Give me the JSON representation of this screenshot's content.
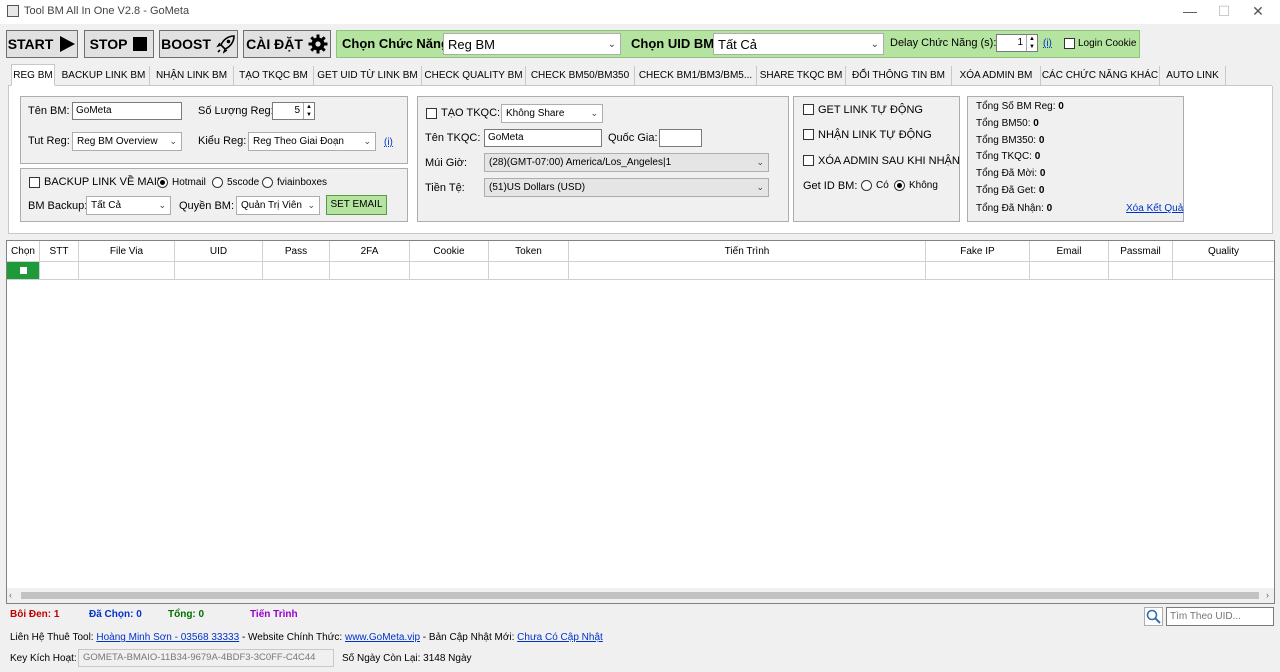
{
  "window": {
    "title": "Tool BM All In One V2.8 - GoMeta",
    "minimize": "—",
    "maximize": "☐",
    "close": "✕"
  },
  "toolbar": {
    "start": "START",
    "stop": "STOP",
    "boost": "BOOST",
    "settings": "CÀI ĐẶT",
    "function_label": "Chọn Chức Năng:",
    "function_value": "Reg BM",
    "uid_label": "Chọn UID BM:",
    "uid_value": "Tất Cả",
    "delay_label": "Delay Chức Năng (s):",
    "delay_value": "1",
    "info": "(i)",
    "login_cookie": "Login Cookie"
  },
  "tabs": [
    "REG BM",
    "BACKUP LINK BM",
    "NHẬN LINK BM",
    "TẠO TKQC BM",
    "GET UID TỪ LINK BM",
    "CHECK QUALITY BM",
    "CHECK BM50/BM350",
    "CHECK BM1/BM3/BM5...",
    "SHARE TKQC BM",
    "ĐỔI THÔNG TIN BM",
    "XÓA ADMIN BM",
    "CÁC CHỨC NĂNG KHÁC",
    "AUTO LINK"
  ],
  "reg": {
    "name_label": "Tên BM:",
    "name_value": "GoMeta",
    "qty_label": "Số Lượng Reg:",
    "qty_value": "5",
    "tut_label": "Tut Reg:",
    "tut_value": "Reg BM Overview",
    "type_label": "Kiểu Reg:",
    "type_value": "Reg Theo Giai Đoạn",
    "info": "(i)"
  },
  "backup": {
    "label": "BACKUP LINK VỀ MAIL:",
    "options": [
      "Hotmail",
      "5scode",
      "fviainboxes"
    ],
    "bm_label": "BM Backup:",
    "bm_value": "Tất Cả",
    "perm_label": "Quyền BM:",
    "perm_value": "Quản Trị Viên",
    "set_email": "SET EMAIL"
  },
  "tkqc": {
    "create_label": "TẠO TKQC:",
    "share_value": "Không Share",
    "name_label": "Tên TKQC:",
    "name_value": "GoMeta",
    "country_label": "Quốc Gia:",
    "country_value": "",
    "tz_label": "Múi Giờ:",
    "tz_value": "(28)(GMT-07:00) America/Los_Angeles|1",
    "currency_label": "Tiền Tệ:",
    "currency_value": "(51)US Dollars (USD)"
  },
  "auto": {
    "get_link": "GET LINK TỰ ĐỘNG",
    "receive_link": "NHẬN LINK TỰ ĐỘNG",
    "delete_admin": "XÓA ADMIN SAU KHI NHẬN",
    "getid_label": "Get ID BM:",
    "yes": "Có",
    "no": "Không"
  },
  "stats": [
    {
      "label": "Tổng Số BM Reg:",
      "value": "0"
    },
    {
      "label": "Tổng BM50:",
      "value": "0"
    },
    {
      "label": "Tổng BM350:",
      "value": "0"
    },
    {
      "label": "Tổng TKQC:",
      "value": "0"
    },
    {
      "label": "Tổng Đã Mời:",
      "value": "0"
    },
    {
      "label": "Tổng Đã Get:",
      "value": "0"
    },
    {
      "label": "Tổng Đã Nhận:",
      "value": "0"
    }
  ],
  "clear_results": "Xóa Kết Quả",
  "columns": [
    "Chọn",
    "STT",
    "File Via",
    "UID",
    "Pass",
    "2FA",
    "Cookie",
    "Token",
    "Tiến Trình",
    "Fake IP",
    "Email",
    "Passmail",
    "Quality"
  ],
  "status": {
    "highlighted": "Bôi Đen: 1",
    "selected": "Đã Chọn: 0",
    "total": "Tổng: 0",
    "progress": "Tiến Trình"
  },
  "search": {
    "placeholder": "Tìm Theo UID..."
  },
  "footer": {
    "contact_label": "Liên Hệ Thuê Tool:",
    "contact_link": "Hoàng Minh Sơn - 03568 33333",
    "website_label": "- Website Chính Thức:",
    "website_link": "www.GoMeta.vip",
    "update_label": "- Bản Cập Nhật Mới:",
    "update_link": "Chưa Có Cập Nhật",
    "key_label": "Key Kích Hoạt:",
    "key_value": "GOMETA-BMAIO-11B34-9679A-4BDF3-3C0FF-C4C44",
    "days_left": "Số Ngày Còn Lại: 3148 Ngày"
  },
  "colors": {
    "green_bar": "#b5e4a0",
    "status_highlight": "#c00000",
    "status_selected": "#0033cc",
    "status_total": "#007000",
    "status_progress": "#9900cc"
  }
}
